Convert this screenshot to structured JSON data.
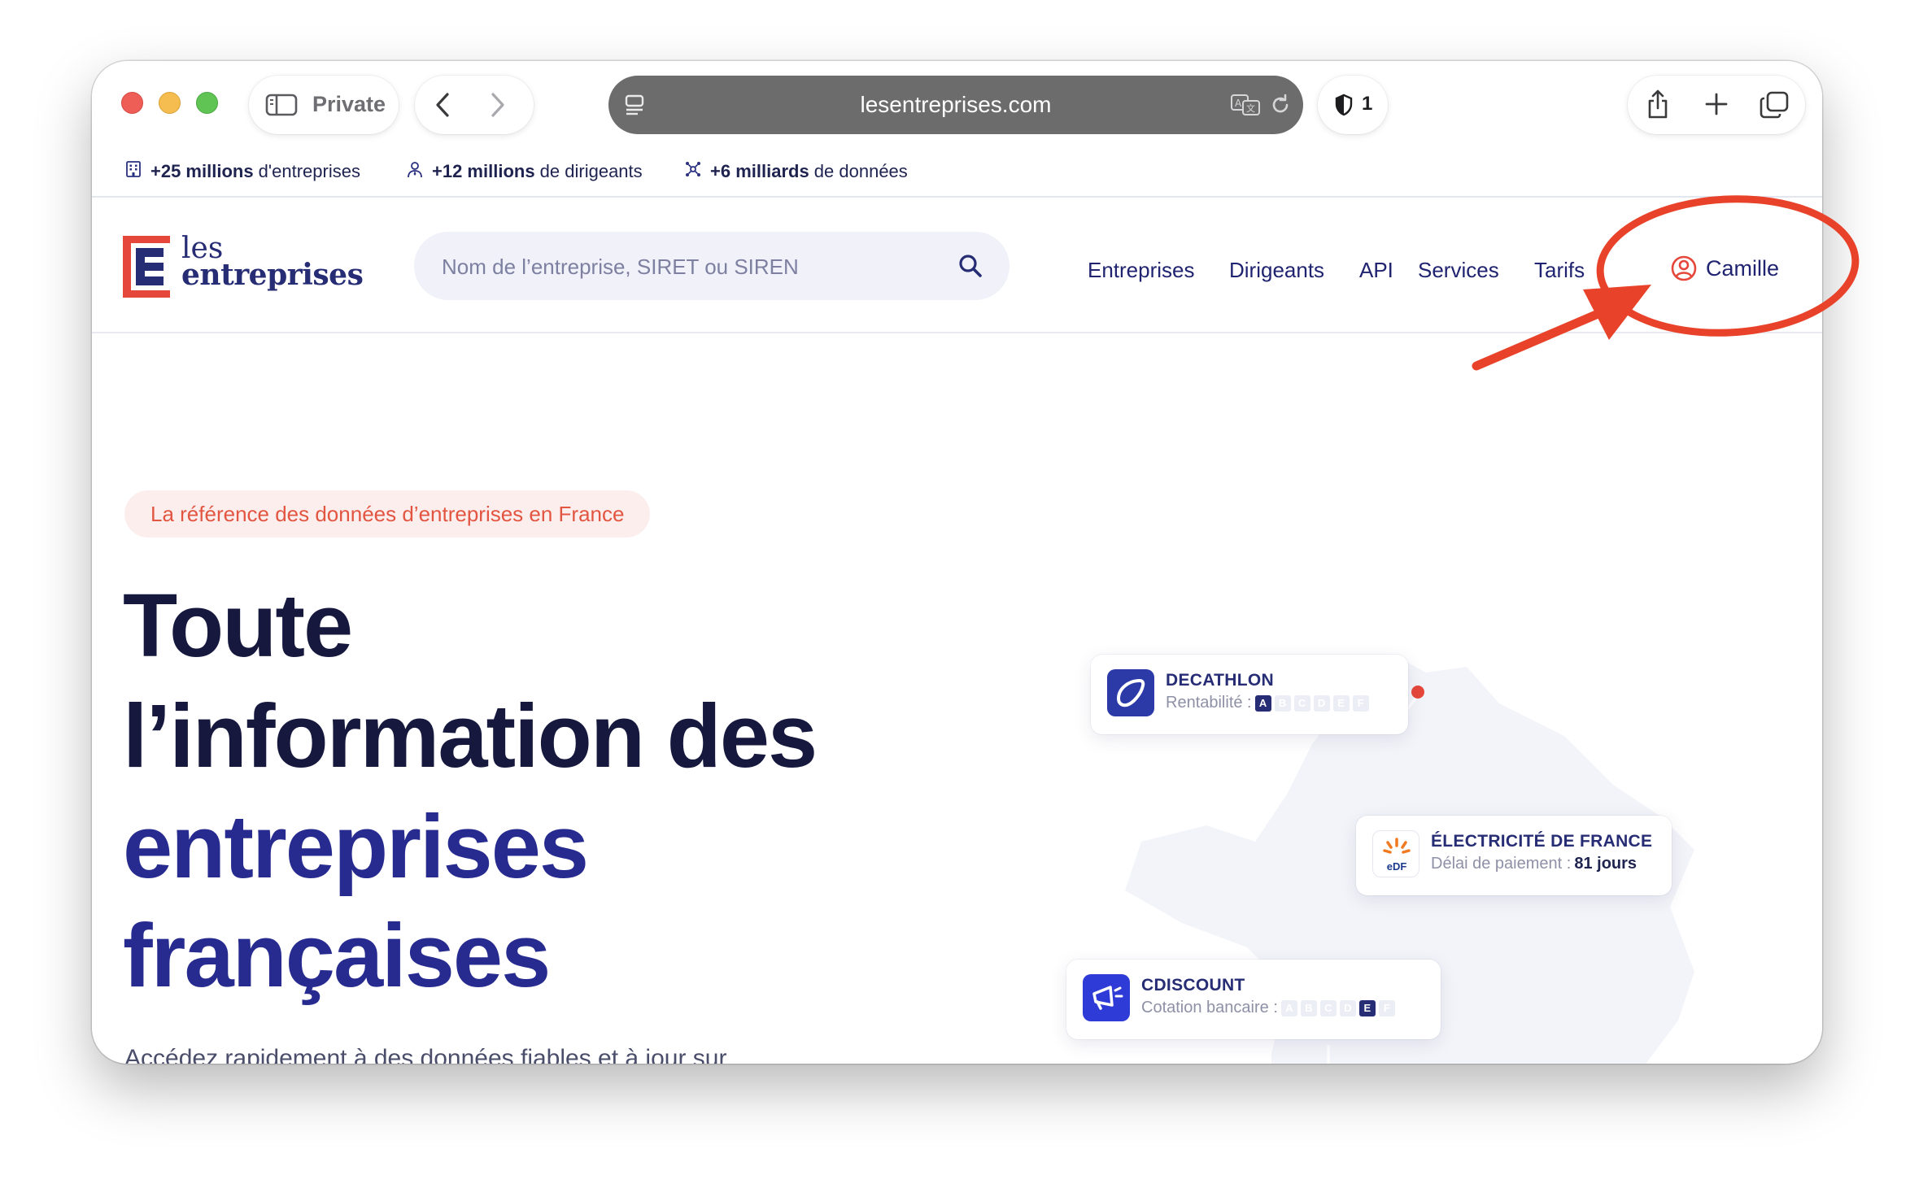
{
  "browser": {
    "private_label": "Private",
    "url": "lesentreprises.com",
    "shield_count": "1"
  },
  "stats": [
    {
      "bold": "+25 millions",
      "text": " d'entreprises",
      "icon": "building-icon"
    },
    {
      "bold": "+12 millions",
      "text": " de dirigeants",
      "icon": "person-icon"
    },
    {
      "bold": "+6 milliards",
      "text": " de données",
      "icon": "network-icon"
    }
  ],
  "header": {
    "logo_line1": "les",
    "logo_line2": "entreprises",
    "search_placeholder": "Nom de l’entreprise, SIRET ou SIREN",
    "nav": [
      "Entreprises",
      "Dirigeants",
      "API",
      "Services",
      "Tarifs"
    ],
    "user_name": "Camille"
  },
  "hero": {
    "badge": "La référence des données d’entreprises en France",
    "title_line1": "Toute",
    "title_line2": "l’information des",
    "title_line3": "entreprises",
    "title_line4": "françaises",
    "subtitle": "Accédez rapidement à des données fiables et à jour sur"
  },
  "cards": [
    {
      "name": "DECATHLON",
      "metric_label": "Rentabilité :",
      "grades": [
        "A",
        "B",
        "C",
        "D",
        "E",
        "F"
      ],
      "active_grade": "A"
    },
    {
      "name": "ÉLECTRICITÉ DE FRANCE",
      "metric_label": "Délai de paiement :",
      "metric_value": "81 jours",
      "logo_text": "eDF"
    },
    {
      "name": "CDISCOUNT",
      "metric_label": "Cotation bancaire :",
      "grades": [
        "A",
        "B",
        "C",
        "D",
        "E",
        "F"
      ],
      "active_grade": "E"
    }
  ],
  "colors": {
    "brand_navy": "#272d74",
    "brand_red": "#e5473a",
    "annotation_red": "#e8432a",
    "hero_dark": "#16183e"
  }
}
